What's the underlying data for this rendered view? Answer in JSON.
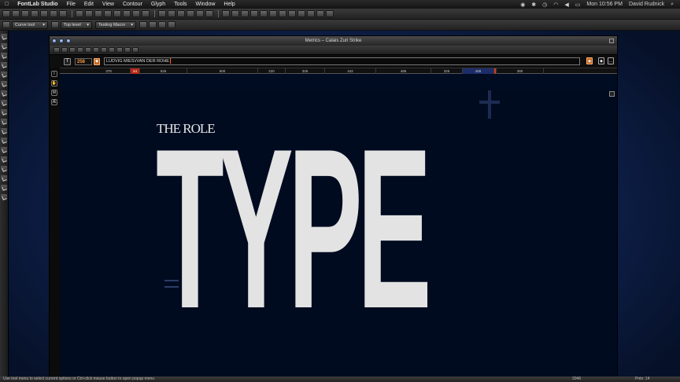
{
  "menubar": {
    "apple": "",
    "app_name": "FontLab Studio",
    "items": [
      "File",
      "Edit",
      "View",
      "Contour",
      "Glyph",
      "Tools",
      "Window",
      "Help"
    ],
    "clock": "Mon 10:56 PM",
    "user": "David Rudnick"
  },
  "toolbar": {
    "mode_combo": "Curve tool",
    "level_combo": "Top level",
    "macro_combo": "Testing Macro"
  },
  "window": {
    "title": "Metrics – Calais Zuri Strike"
  },
  "text_row": {
    "font_size": "256",
    "text": "LUDVIG MIES\\/VAN DER ROHE",
    "ellipsis": "..."
  },
  "metrics": {
    "cells": [
      "378",
      "44",
      "526",
      "600",
      "220",
      "326",
      "442",
      "486",
      "326",
      "488",
      "380"
    ]
  },
  "canvas": {
    "headline_small": "THE ROLE",
    "headline_big": "TYPE"
  },
  "status": {
    "hint": "Use tool menu to select current options or Ctrl-click mouse button to open popup menu",
    "coords": "2046",
    "points": "Pnts: 14"
  },
  "colors": {
    "accent": "#ff7a2a",
    "canvas_bg": "#000b20",
    "highlight_cell": "#b92816"
  }
}
